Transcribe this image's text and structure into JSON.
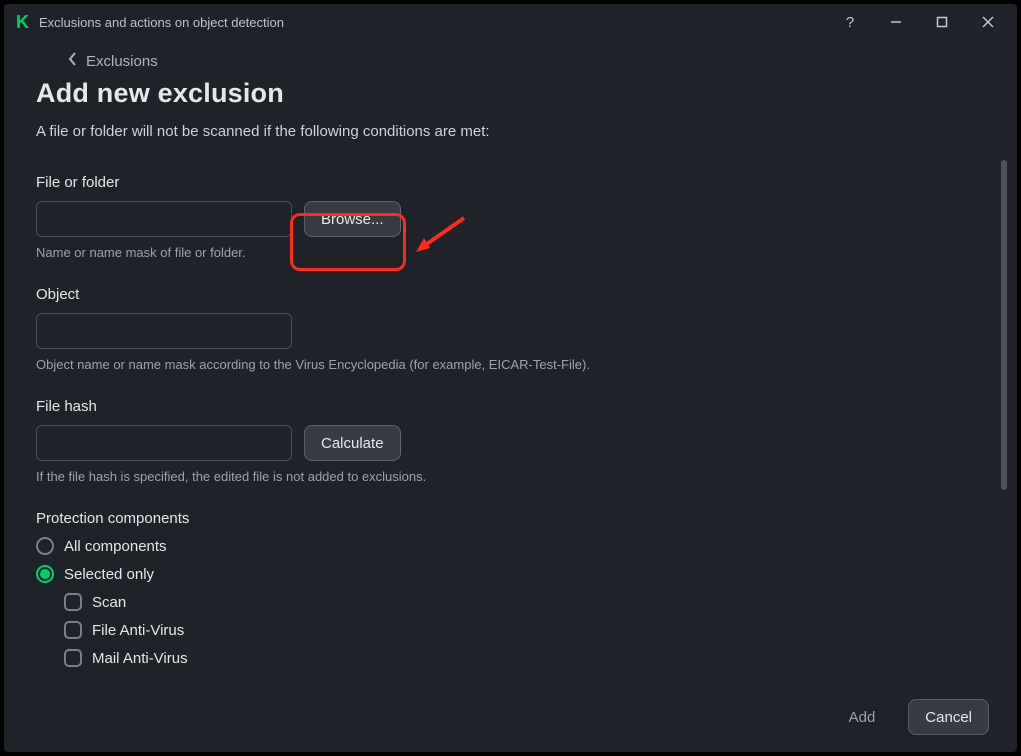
{
  "titlebar": {
    "title": "Exclusions and actions on object detection"
  },
  "breadcrumb": {
    "label": "Exclusions"
  },
  "page": {
    "heading": "Add new exclusion",
    "intro": "A file or folder will not be scanned if the following conditions are met:"
  },
  "file_group": {
    "label": "File or folder",
    "browse": "Browse...",
    "hint": "Name or name mask of file or folder."
  },
  "object_group": {
    "label": "Object",
    "hint": "Object name or name mask according to the Virus Encyclopedia (for example, EICAR-Test-File)."
  },
  "hash_group": {
    "label": "File hash",
    "calculate": "Calculate",
    "hint": "If the file hash is specified, the edited file is not added to exclusions."
  },
  "protection": {
    "label": "Protection components",
    "all": "All components",
    "selected": "Selected only",
    "checks": {
      "scan": "Scan",
      "file_av": "File Anti-Virus",
      "mail_av": "Mail Anti-Virus"
    }
  },
  "bottom": {
    "add": "Add",
    "cancel": "Cancel"
  }
}
